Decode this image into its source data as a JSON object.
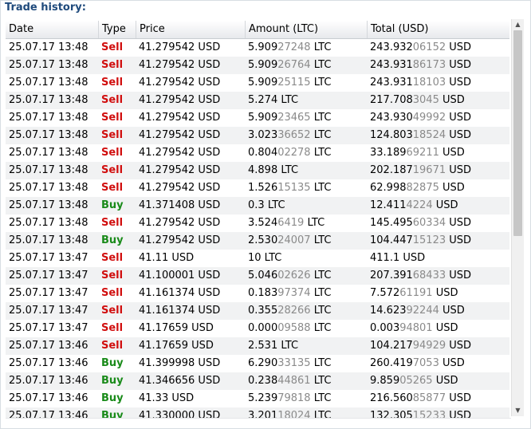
{
  "title": "Trade history:",
  "columns": [
    "Date",
    "Type",
    "Price",
    "Amount (LTC)",
    "Total (USD)"
  ],
  "rows": [
    {
      "date": "25.07.17 13:48",
      "type": "Sell",
      "price": "41.279542 USD",
      "amt_main": "5.909",
      "amt_dim": "27248",
      "amt_unit": " LTC",
      "tot_main": "243.932",
      "tot_dim": "06152",
      "tot_unit": " USD"
    },
    {
      "date": "25.07.17 13:48",
      "type": "Sell",
      "price": "41.279542 USD",
      "amt_main": "5.909",
      "amt_dim": "26764",
      "amt_unit": " LTC",
      "tot_main": "243.931",
      "tot_dim": "86173",
      "tot_unit": " USD"
    },
    {
      "date": "25.07.17 13:48",
      "type": "Sell",
      "price": "41.279542 USD",
      "amt_main": "5.909",
      "amt_dim": "25115",
      "amt_unit": " LTC",
      "tot_main": "243.931",
      "tot_dim": "18103",
      "tot_unit": " USD"
    },
    {
      "date": "25.07.17 13:48",
      "type": "Sell",
      "price": "41.279542 USD",
      "amt_main": "5.274",
      "amt_dim": "",
      "amt_unit": " LTC",
      "tot_main": "217.708",
      "tot_dim": "3045",
      "tot_unit": " USD"
    },
    {
      "date": "25.07.17 13:48",
      "type": "Sell",
      "price": "41.279542 USD",
      "amt_main": "5.909",
      "amt_dim": "23465",
      "amt_unit": " LTC",
      "tot_main": "243.930",
      "tot_dim": "49992",
      "tot_unit": " USD"
    },
    {
      "date": "25.07.17 13:48",
      "type": "Sell",
      "price": "41.279542 USD",
      "amt_main": "3.023",
      "amt_dim": "36652",
      "amt_unit": " LTC",
      "tot_main": "124.803",
      "tot_dim": "18524",
      "tot_unit": " USD"
    },
    {
      "date": "25.07.17 13:48",
      "type": "Sell",
      "price": "41.279542 USD",
      "amt_main": "0.804",
      "amt_dim": "02278",
      "amt_unit": " LTC",
      "tot_main": "33.189",
      "tot_dim": "69211",
      "tot_unit": " USD"
    },
    {
      "date": "25.07.17 13:48",
      "type": "Sell",
      "price": "41.279542 USD",
      "amt_main": "4.898",
      "amt_dim": "",
      "amt_unit": " LTC",
      "tot_main": "202.187",
      "tot_dim": "19671",
      "tot_unit": " USD"
    },
    {
      "date": "25.07.17 13:48",
      "type": "Sell",
      "price": "41.279542 USD",
      "amt_main": "1.526",
      "amt_dim": "15135",
      "amt_unit": " LTC",
      "tot_main": "62.998",
      "tot_dim": "82875",
      "tot_unit": " USD"
    },
    {
      "date": "25.07.17 13:48",
      "type": "Buy",
      "price": "41.371408 USD",
      "amt_main": "0.3",
      "amt_dim": "",
      "amt_unit": " LTC",
      "tot_main": "12.411",
      "tot_dim": "4224",
      "tot_unit": " USD"
    },
    {
      "date": "25.07.17 13:48",
      "type": "Sell",
      "price": "41.279542 USD",
      "amt_main": "3.524",
      "amt_dim": "6419",
      "amt_unit": " LTC",
      "tot_main": "145.495",
      "tot_dim": "60334",
      "tot_unit": " USD"
    },
    {
      "date": "25.07.17 13:48",
      "type": "Buy",
      "price": "41.279542 USD",
      "amt_main": "2.530",
      "amt_dim": "24007",
      "amt_unit": " LTC",
      "tot_main": "104.447",
      "tot_dim": "15123",
      "tot_unit": " USD"
    },
    {
      "date": "25.07.17 13:47",
      "type": "Sell",
      "price": "41.11 USD",
      "amt_main": "10",
      "amt_dim": "",
      "amt_unit": " LTC",
      "tot_main": "411.1",
      "tot_dim": "",
      "tot_unit": " USD"
    },
    {
      "date": "25.07.17 13:47",
      "type": "Sell",
      "price": "41.100001 USD",
      "amt_main": "5.046",
      "amt_dim": "02626",
      "amt_unit": " LTC",
      "tot_main": "207.391",
      "tot_dim": "68433",
      "tot_unit": " USD"
    },
    {
      "date": "25.07.17 13:47",
      "type": "Sell",
      "price": "41.161374 USD",
      "amt_main": "0.183",
      "amt_dim": "97374",
      "amt_unit": " LTC",
      "tot_main": "7.572",
      "tot_dim": "61191",
      "tot_unit": " USD"
    },
    {
      "date": "25.07.17 13:47",
      "type": "Sell",
      "price": "41.161374 USD",
      "amt_main": "0.355",
      "amt_dim": "28266",
      "amt_unit": " LTC",
      "tot_main": "14.623",
      "tot_dim": "92244",
      "tot_unit": " USD"
    },
    {
      "date": "25.07.17 13:47",
      "type": "Sell",
      "price": "41.17659 USD",
      "amt_main": "0.000",
      "amt_dim": "09588",
      "amt_unit": " LTC",
      "tot_main": "0.003",
      "tot_dim": "94801",
      "tot_unit": " USD"
    },
    {
      "date": "25.07.17 13:46",
      "type": "Sell",
      "price": "41.17659 USD",
      "amt_main": "2.531",
      "amt_dim": "",
      "amt_unit": " LTC",
      "tot_main": "104.217",
      "tot_dim": "94929",
      "tot_unit": " USD"
    },
    {
      "date": "25.07.17 13:46",
      "type": "Buy",
      "price": "41.399998 USD",
      "amt_main": "6.290",
      "amt_dim": "33135",
      "amt_unit": " LTC",
      "tot_main": "260.419",
      "tot_dim": "7053",
      "tot_unit": " USD"
    },
    {
      "date": "25.07.17 13:46",
      "type": "Buy",
      "price": "41.346656 USD",
      "amt_main": "0.238",
      "amt_dim": "44861",
      "amt_unit": " LTC",
      "tot_main": "9.859",
      "tot_dim": "05265",
      "tot_unit": " USD"
    },
    {
      "date": "25.07.17 13:46",
      "type": "Buy",
      "price": "41.33 USD",
      "amt_main": "5.239",
      "amt_dim": "79818",
      "amt_unit": " LTC",
      "tot_main": "216.560",
      "tot_dim": "85877",
      "tot_unit": " USD"
    },
    {
      "date": "25.07.17 13:46",
      "type": "Buy",
      "price": "41.330000 USD",
      "amt_main": "3.201",
      "amt_dim": "18024",
      "amt_unit": " LTC",
      "tot_main": "132.305",
      "tot_dim": "15233",
      "tot_unit": " USD"
    }
  ],
  "colors": {
    "sell": "#d10f0f",
    "buy": "#1a8b1a",
    "title": "#1f4a7c",
    "dim_digits": "#8a8a8a"
  },
  "icons": {
    "scroll_up": "scroll-up-arrow-icon",
    "scroll_down": "scroll-down-arrow-icon"
  }
}
